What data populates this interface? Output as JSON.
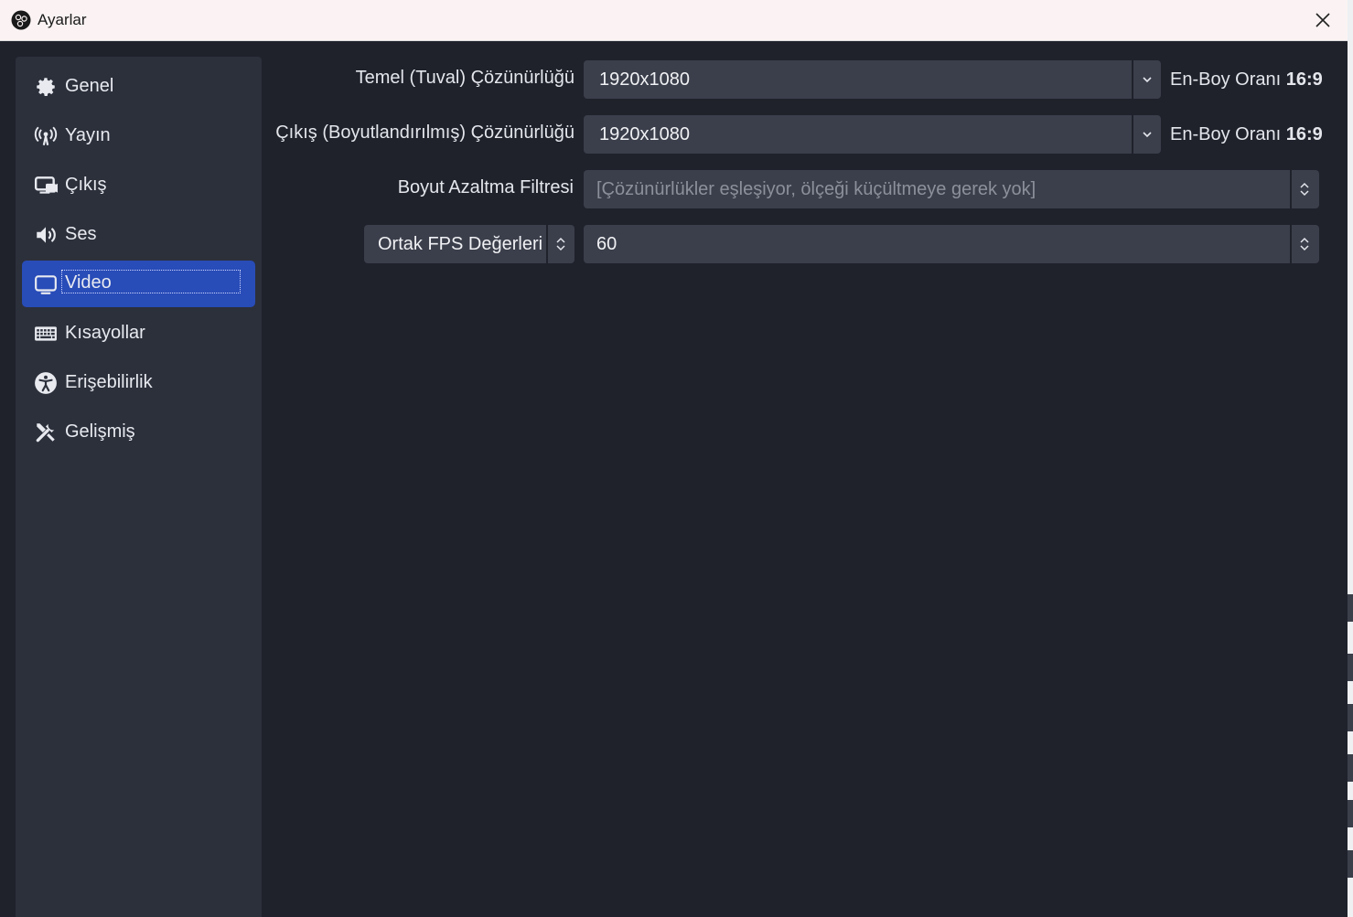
{
  "window": {
    "title": "Ayarlar"
  },
  "sidebar": {
    "items": [
      {
        "label": "Genel",
        "icon": "gear-icon"
      },
      {
        "label": "Yayın",
        "icon": "broadcast-icon"
      },
      {
        "label": "Çıkış",
        "icon": "output-icon"
      },
      {
        "label": "Ses",
        "icon": "speaker-icon"
      },
      {
        "label": "Video",
        "icon": "monitor-icon",
        "active": true
      },
      {
        "label": "Kısayollar",
        "icon": "keyboard-icon"
      },
      {
        "label": "Erişebilirlik",
        "icon": "accessibility-icon"
      },
      {
        "label": "Gelişmiş",
        "icon": "tools-icon"
      }
    ]
  },
  "video": {
    "base_resolution": {
      "label": "Temel (Tuval) Çözünürlüğü",
      "value": "1920x1080",
      "ratio_label": "En-Boy Oranı",
      "ratio_value": "16:9"
    },
    "output_resolution": {
      "label": "Çıkış (Boyutlandırılmış) Çözünürlüğü",
      "value": "1920x1080",
      "ratio_label": "En-Boy Oranı",
      "ratio_value": "16:9"
    },
    "downscale_filter": {
      "label": "Boyut Azaltma Filtresi",
      "value": "[Çözünürlükler eşleşiyor, ölçeği küçültmeye gerek yok]"
    },
    "fps": {
      "type_value": "Ortak FPS Değerleri",
      "value": "60"
    }
  },
  "colors": {
    "background": "#1f222b",
    "sidebar": "#2c303b",
    "accent": "#284cb8",
    "input": "#3b3f4b"
  }
}
